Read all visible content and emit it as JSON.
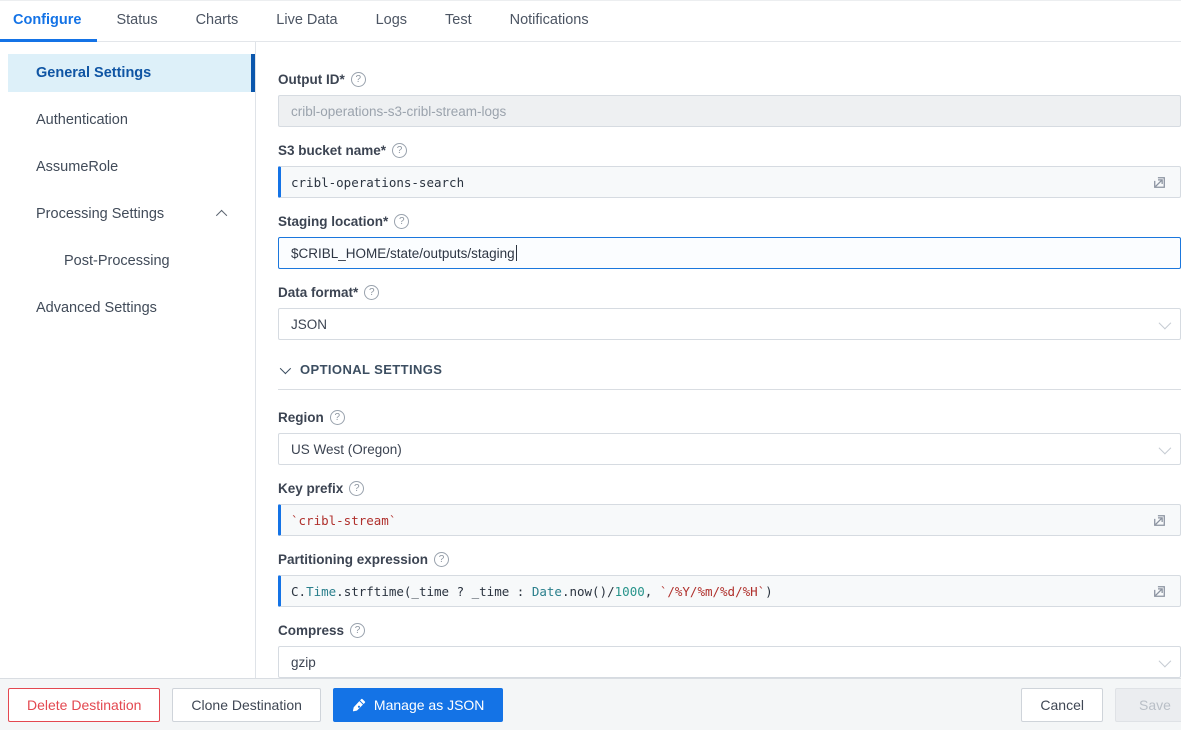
{
  "tabs": {
    "items": [
      {
        "label": "Configure",
        "active": true
      },
      {
        "label": "Status",
        "active": false
      },
      {
        "label": "Charts",
        "active": false
      },
      {
        "label": "Live Data",
        "active": false
      },
      {
        "label": "Logs",
        "active": false
      },
      {
        "label": "Test",
        "active": false
      },
      {
        "label": "Notifications",
        "active": false
      }
    ]
  },
  "sidebar": {
    "items": [
      {
        "label": "General Settings",
        "active": true
      },
      {
        "label": "Authentication",
        "active": false
      },
      {
        "label": "AssumeRole",
        "active": false
      },
      {
        "label": "Processing Settings",
        "active": false,
        "expanded": true
      },
      {
        "label": "Post-Processing",
        "active": false,
        "indent": true
      },
      {
        "label": "Advanced Settings",
        "active": false
      }
    ]
  },
  "form": {
    "output_id": {
      "label": "Output ID*",
      "value": "cribl-operations-s3-cribl-stream-logs",
      "disabled": true
    },
    "bucket": {
      "label": "S3 bucket name*",
      "value": "cribl-operations-search"
    },
    "staging": {
      "label": "Staging location*",
      "value": "$CRIBL_HOME/state/outputs/staging",
      "focused": true
    },
    "format": {
      "label": "Data format*",
      "value": "JSON"
    },
    "optional_header": "OPTIONAL SETTINGS",
    "region": {
      "label": "Region",
      "value": "US West (Oregon)"
    },
    "key_prefix": {
      "label": "Key prefix",
      "value": "`cribl-stream`"
    },
    "partitioning": {
      "label": "Partitioning expression",
      "tokens": [
        {
          "t": "C.",
          "c": "plain"
        },
        {
          "t": "Time",
          "c": "type"
        },
        {
          "t": ".strftime(_time ? _time : ",
          "c": "plain"
        },
        {
          "t": "Date",
          "c": "type"
        },
        {
          "t": ".now()/",
          "c": "plain"
        },
        {
          "t": "1000",
          "c": "number"
        },
        {
          "t": ", ",
          "c": "plain"
        },
        {
          "t": "`/%Y/%m/%d/%H`",
          "c": "string"
        },
        {
          "t": ")",
          "c": "plain"
        }
      ]
    },
    "compress": {
      "label": "Compress",
      "value": "gzip"
    }
  },
  "footer": {
    "delete_label": "Delete Destination",
    "clone_label": "Clone Destination",
    "manage_json_label": "Manage as JSON",
    "cancel_label": "Cancel",
    "save_label": "Save"
  },
  "colors": {
    "accent_blue": "#1473e6",
    "danger_red": "#e34850",
    "active_nav_bg": "#ddf0f9",
    "active_nav_text": "#0f55a4",
    "active_nav_bar": "#0b57ad",
    "code_string_red": "#b0302c",
    "code_type_teal": "#2a7f8c",
    "expr_field_bg": "#f7f9fa",
    "footer_bg": "#f4f6f7"
  }
}
